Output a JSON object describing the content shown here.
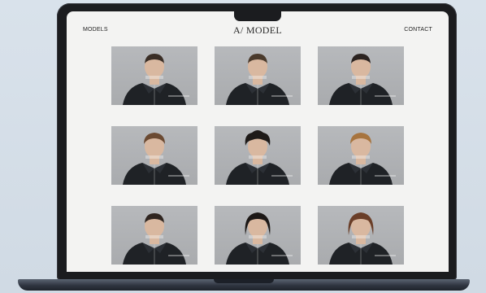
{
  "nav": {
    "left_label": "MODELS",
    "logo": "A/ MODEL",
    "right_label": "CONTACT"
  },
  "models": [
    {
      "hair": "#3a2e26",
      "hair_style": "short"
    },
    {
      "hair": "#4a3a2c",
      "hair_style": "short"
    },
    {
      "hair": "#2b2320",
      "hair_style": "short"
    },
    {
      "hair": "#6b4a32",
      "hair_style": "wavy"
    },
    {
      "hair": "#1e1a18",
      "hair_style": "curly"
    },
    {
      "hair": "#a7743e",
      "hair_style": "wavy"
    },
    {
      "hair": "#2f2520",
      "hair_style": "short"
    },
    {
      "hair": "#1c1816",
      "hair_style": "long"
    },
    {
      "hair": "#6a3e28",
      "hair_style": "long"
    }
  ],
  "colors": {
    "card_background": "#afb1b4",
    "jacket": "#1f2226",
    "skin": "#d9b8a0",
    "page_background": "#f3f3f2"
  }
}
